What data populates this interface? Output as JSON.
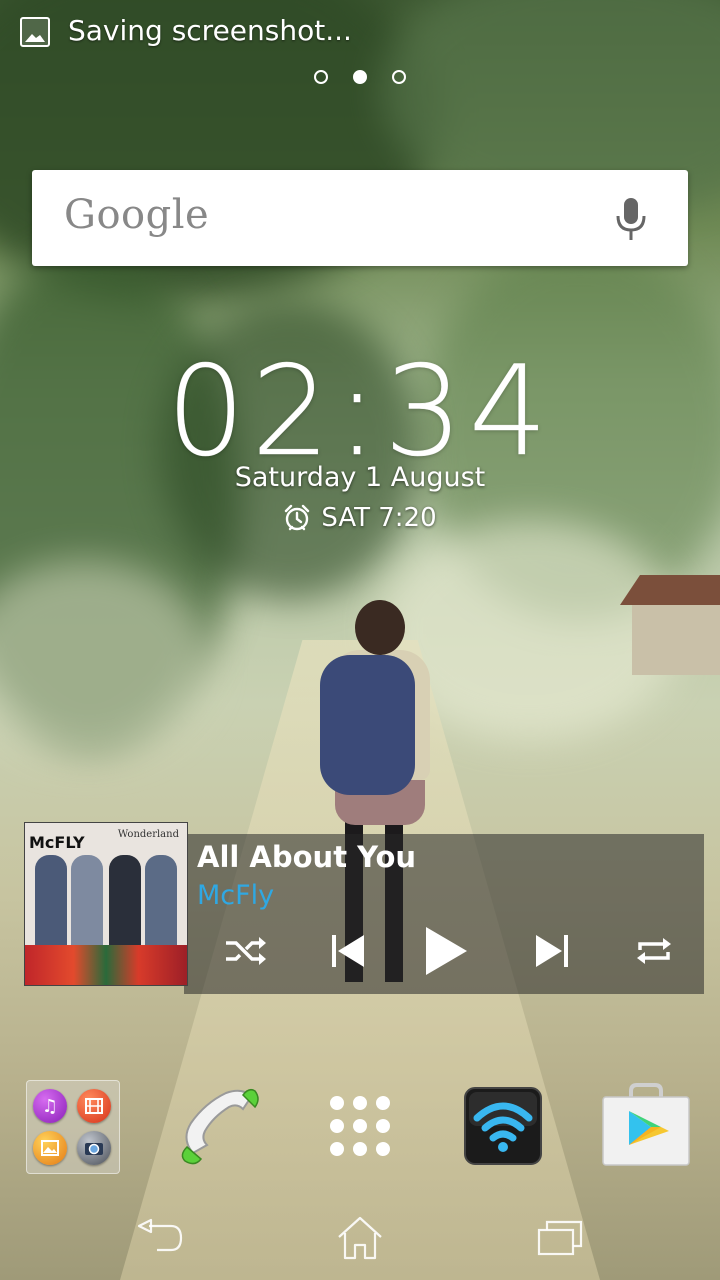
{
  "status_bar": {
    "notification_text": "Saving screenshot..."
  },
  "home": {
    "page_count": 3,
    "active_page": 2
  },
  "search": {
    "logo_text": "Google"
  },
  "clock": {
    "time": "02:34",
    "date": "Saturday 1 August",
    "alarm": "SAT 7:20"
  },
  "music": {
    "title": "All About You",
    "artist": "McFly",
    "album_band_text": "McFLY",
    "album_subtitle": "Wonderland",
    "accent_color": "#2fa8e3"
  },
  "dock": {
    "folder_apps": [
      "music-icon",
      "movies-icon",
      "album-icon",
      "camera-icon"
    ],
    "apps": [
      "phone-icon",
      "apps-drawer-icon",
      "wifi-icon",
      "play-store-icon"
    ]
  },
  "navbar": {
    "buttons": [
      "back-icon",
      "home-icon",
      "recents-icon"
    ]
  }
}
